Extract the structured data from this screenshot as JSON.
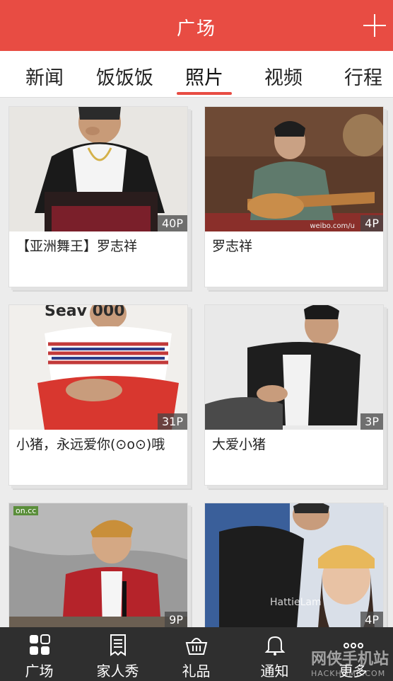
{
  "header": {
    "title": "广场"
  },
  "tabs": [
    {
      "label": "新闻"
    },
    {
      "label": "饭饭饭"
    },
    {
      "label": "照片"
    },
    {
      "label": "视频"
    },
    {
      "label": "行程"
    }
  ],
  "active_tab": "照片",
  "accent_color": "#e84c43",
  "cards": [
    {
      "count": "40P",
      "caption": "【亚洲舞王】罗志祥"
    },
    {
      "count": "4P",
      "caption": "罗志祥"
    },
    {
      "count": "31P",
      "caption": "小猪，永远爱你(⊙o⊙)哦"
    },
    {
      "count": "3P",
      "caption": "大爱小猪"
    },
    {
      "count": "9P",
      "caption": ""
    },
    {
      "count": "4P",
      "caption": ""
    }
  ],
  "photo_text": {
    "card2_credit": "weibo.com/u",
    "card3_banner": "Seav  000",
    "card5_logo": "on.cc",
    "card6_watermark": "HattieLam"
  },
  "bottom_nav": [
    {
      "label": "广场",
      "icon": "grid-icon"
    },
    {
      "label": "家人秀",
      "icon": "document-icon"
    },
    {
      "label": "礼品",
      "icon": "basket-icon"
    },
    {
      "label": "通知",
      "icon": "bell-icon"
    },
    {
      "label": "更多",
      "icon": "more-icon"
    }
  ],
  "watermark": {
    "main": "网侠手机站",
    "sub": "HACKHOME.COM"
  }
}
